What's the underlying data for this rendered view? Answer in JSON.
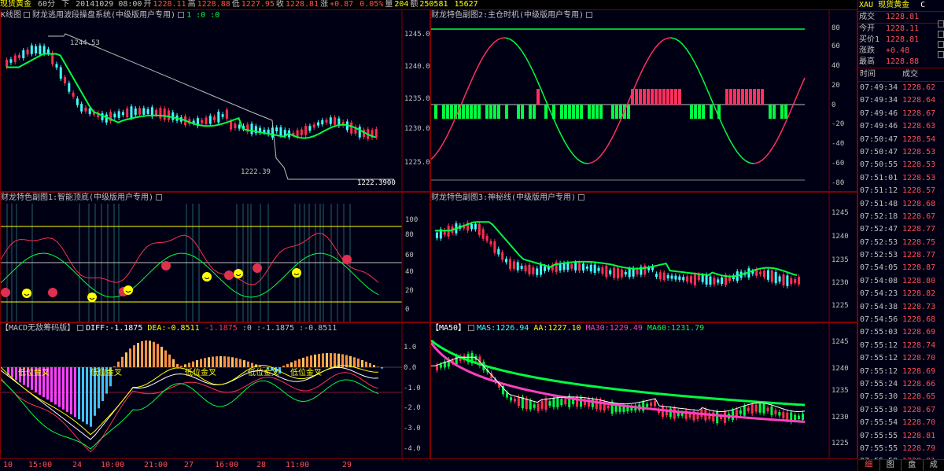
{
  "topbar": {
    "name": "现货黄金",
    "period": "60分",
    "dir": "下",
    "datetime": "20141029 08:00",
    "open_label": "开",
    "open": "1228.11",
    "high_label": "高",
    "high": "1228.88",
    "low_label": "低",
    "low": "1227.95",
    "close_label": "收",
    "close": "1228.81",
    "change_label": "涨",
    "change": "+0.87",
    "change_pct": "0.05%",
    "vol_label": "量",
    "vol": "204",
    "amount_label": "额",
    "amount": "250581",
    "extra": "15627"
  },
  "main_panel": {
    "title": "K线图",
    "indicator": "财龙逃用波段操盘系统(中级版用户专用)",
    "params": "1 :0 :0",
    "high_mark": "1244.53",
    "low_mark": "1222.39",
    "price_box": "1222.3900",
    "yticks": [
      "1245.0",
      "1240.0",
      "1235.0",
      "1230.0",
      "1225.0"
    ]
  },
  "sub1_panel": {
    "title": "财龙特色副图1:智能顶底(中级版用户专用)",
    "yticks": [
      "100",
      "80",
      "60",
      "40",
      "20",
      "0"
    ]
  },
  "macd_panel": {
    "title": "【MACD无敌筹码版】",
    "diff_label": "DIFF:",
    "diff": "-1.1875",
    "dea_label": "DEA:",
    "dea": "-0.8511",
    "v3": "-1.1875",
    "v4": ":0",
    "v5": ":-1.1875",
    "v6": ":-0.8511",
    "signals": [
      "低位金叉",
      "低位金叉",
      "低位金叉",
      "低位金叉",
      "低位金叉"
    ],
    "yticks": [
      "1.0",
      "0.0",
      "-1.0",
      "-2.0",
      "-3.0",
      "-4.0"
    ]
  },
  "sub2_panel": {
    "title": "财龙特色副图2:主仓时机(中级版用户专用)",
    "yticks": [
      "80",
      "60",
      "40",
      "20",
      "0",
      "-20",
      "-40",
      "-60",
      "-80"
    ]
  },
  "sub3_panel": {
    "title": "财龙特色副图3:神秘线(中级版用户专用)",
    "yticks": [
      "1245",
      "1240",
      "1235",
      "1230",
      "1225"
    ]
  },
  "ma_panel": {
    "title": "【MA50】",
    "mas_label": "MAS:",
    "mas": "1226.94",
    "aa_label": "AA:",
    "aa": "1227.10",
    "ma30_label": "MA30:",
    "ma30": "1229.49",
    "ma60_label": "MA60:",
    "ma60": "1231.79",
    "yticks": [
      "1245",
      "1240",
      "1235",
      "1230",
      "1225"
    ]
  },
  "xaxis": [
    "10",
    "15:00",
    "24",
    "10:00",
    "21:00",
    "27",
    "16:00",
    "28",
    "11:00",
    "29"
  ],
  "quote": {
    "code": "XAU",
    "name": "现货黄金",
    "extra": "C",
    "rows": [
      {
        "k": "成交",
        "v": "1228.81"
      },
      {
        "k": "今开",
        "v": "1228.11"
      },
      {
        "k": "买价1",
        "v": "1228.81"
      },
      {
        "k": "涨跌",
        "v": "+0.48"
      },
      {
        "k": "最高",
        "v": "1228.88"
      }
    ],
    "tick_head_time": "时间",
    "tick_head_price": "成交",
    "ticks": [
      {
        "t": "07:49:34",
        "p": "1228.62"
      },
      {
        "t": "07:49:34",
        "p": "1228.64"
      },
      {
        "t": "07:49:46",
        "p": "1228.67"
      },
      {
        "t": "07:49:46",
        "p": "1228.63"
      },
      {
        "t": "07:50:47",
        "p": "1228.54"
      },
      {
        "t": "07:50:47",
        "p": "1228.53"
      },
      {
        "t": "07:50:55",
        "p": "1228.53"
      },
      {
        "t": "07:51:01",
        "p": "1228.53"
      },
      {
        "t": "07:51:12",
        "p": "1228.57"
      },
      {
        "t": "07:51:48",
        "p": "1228.68"
      },
      {
        "t": "07:52:18",
        "p": "1228.67"
      },
      {
        "t": "07:52:47",
        "p": "1228.77"
      },
      {
        "t": "07:52:53",
        "p": "1228.75"
      },
      {
        "t": "07:52:53",
        "p": "1228.77"
      },
      {
        "t": "07:54:05",
        "p": "1228.87"
      },
      {
        "t": "07:54:08",
        "p": "1228.80"
      },
      {
        "t": "07:54:23",
        "p": "1228.82"
      },
      {
        "t": "07:54:38",
        "p": "1228.73"
      },
      {
        "t": "07:54:56",
        "p": "1228.68"
      },
      {
        "t": "07:55:03",
        "p": "1228.69"
      },
      {
        "t": "07:55:12",
        "p": "1228.74"
      },
      {
        "t": "07:55:12",
        "p": "1228.70"
      },
      {
        "t": "07:55:12",
        "p": "1228.69"
      },
      {
        "t": "07:55:24",
        "p": "1228.66"
      },
      {
        "t": "07:55:30",
        "p": "1228.65"
      },
      {
        "t": "07:55:30",
        "p": "1228.67"
      },
      {
        "t": "07:55:54",
        "p": "1228.70"
      },
      {
        "t": "07:55:55",
        "p": "1228.81"
      },
      {
        "t": "07:55:55",
        "p": "1228.79"
      },
      {
        "t": "07:55:59",
        "p": "1228.81"
      }
    ],
    "tabs": [
      "细",
      "图",
      "盘",
      "成"
    ]
  },
  "colors": {
    "up": "#ff3050",
    "down": "#40ffff",
    "ma_green": "#00ff40",
    "ma_pink": "#ff40c0",
    "frame": "#800000",
    "bg": "#000014"
  }
}
